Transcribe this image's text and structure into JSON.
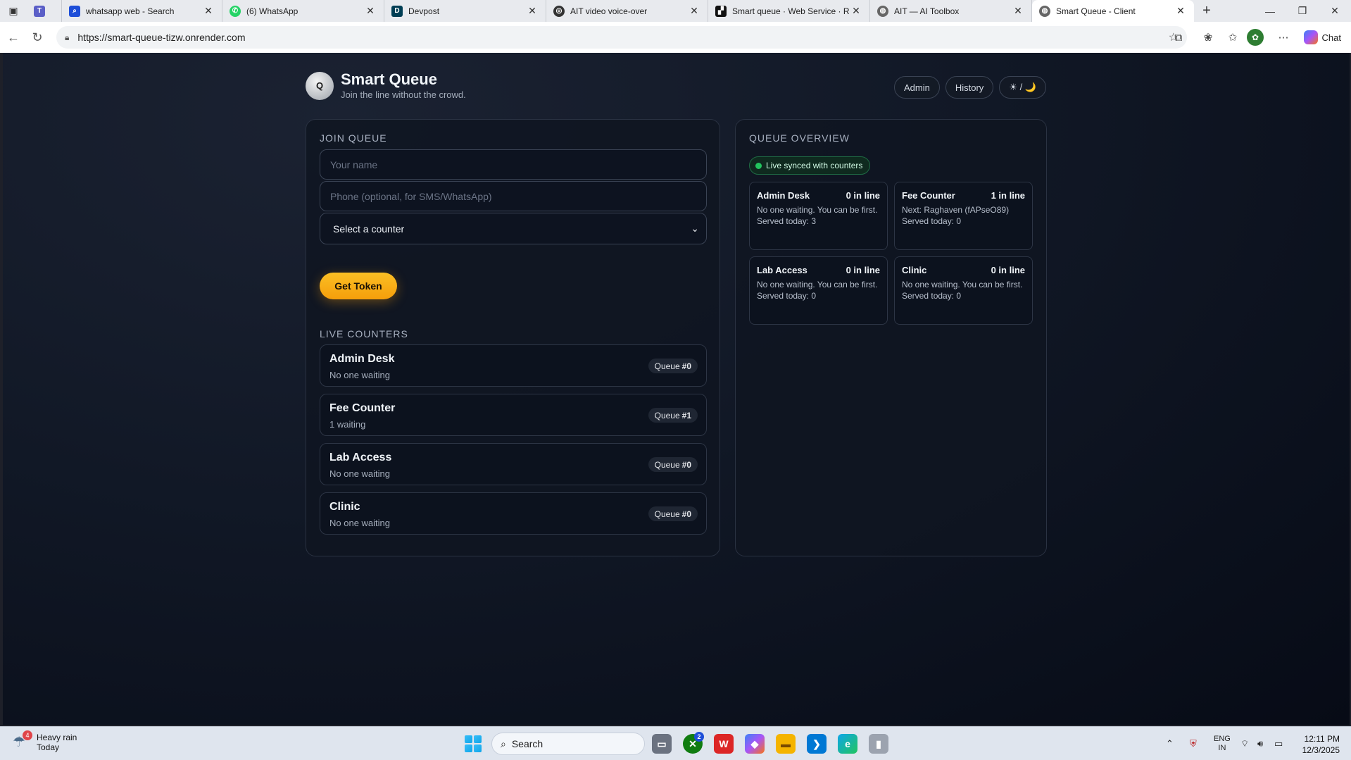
{
  "browser": {
    "tabs": [
      {
        "title": "",
        "favicon": "teams-icon",
        "color": "#5b5fc7"
      },
      {
        "title": "whatsapp web - Search",
        "favicon": "search-icon",
        "color": "#1d4ed8"
      },
      {
        "title": "(6) WhatsApp",
        "favicon": "whatsapp-icon",
        "color": "#25d366"
      },
      {
        "title": "Devpost",
        "favicon": "devpost-icon",
        "color": "#003e54"
      },
      {
        "title": "AIT video voice-over",
        "favicon": "ai-icon",
        "color": "#333333"
      },
      {
        "title": "Smart queue · Web Service · Re",
        "favicon": "render-icon",
        "color": "#111111"
      },
      {
        "title": "AIT — AI Toolbox",
        "favicon": "globe-icon",
        "color": "#555555"
      },
      {
        "title": "Smart Queue - Client",
        "favicon": "globe-icon",
        "color": "#555555"
      }
    ],
    "url": "https://smart-queue-tizw.onrender.com",
    "chat_label": "Chat"
  },
  "app": {
    "logo_letter": "Q",
    "title": "Smart Queue",
    "subtitle": "Join the line without the crowd.",
    "admin_label": "Admin",
    "history_label": "History",
    "theme_label": "☀ / 🌙"
  },
  "join": {
    "section_title": "JOIN QUEUE",
    "name_placeholder": "Your name",
    "phone_placeholder": "Phone (optional, for SMS/WhatsApp)",
    "select_value": "Select a counter",
    "button_label": "Get Token"
  },
  "live": {
    "section_title": "LIVE COUNTERS",
    "queue_prefix": "Queue",
    "counters": [
      {
        "name": "Admin Desk",
        "status": "No one waiting",
        "queue": "#0"
      },
      {
        "name": "Fee Counter",
        "status": "1 waiting",
        "queue": "#1"
      },
      {
        "name": "Lab Access",
        "status": "No one waiting",
        "queue": "#0"
      },
      {
        "name": "Clinic",
        "status": "No one waiting",
        "queue": "#0"
      }
    ]
  },
  "overview": {
    "section_title": "QUEUE OVERVIEW",
    "sync_label": "Live synced with counters",
    "cards": [
      {
        "name": "Admin Desk",
        "count": "0 in line",
        "text": "No one waiting. You can be first.",
        "served": "Served today: 3"
      },
      {
        "name": "Fee Counter",
        "count": "1 in line",
        "text": "Next: Raghaven (fAPseO89)",
        "served": "Served today: 0"
      },
      {
        "name": "Lab Access",
        "count": "0 in line",
        "text": "No one waiting. You can be first.",
        "served": "Served today: 0"
      },
      {
        "name": "Clinic",
        "count": "0 in line",
        "text": "No one waiting. You can be first.",
        "served": "Served today: 0"
      }
    ]
  },
  "taskbar": {
    "weather_title": "Heavy rain",
    "weather_sub": "Today",
    "weather_badge": "4",
    "search_label": "Search",
    "lang_top": "ENG",
    "lang_bottom": "IN",
    "time": "12:11 PM",
    "date": "12/3/2025",
    "xbox_badge": "2"
  }
}
